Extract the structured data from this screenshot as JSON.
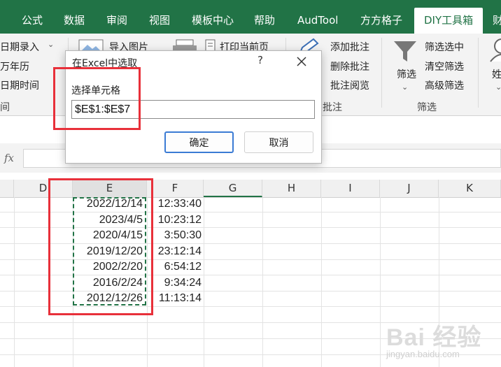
{
  "ribbon_tabs": [
    "公式",
    "数据",
    "审阅",
    "视图",
    "模板中心",
    "帮助",
    "AudTool",
    "方方格子",
    "DIY工具箱",
    "财"
  ],
  "active_tab_index": 8,
  "ribbon": {
    "left_items": [
      "日期录入",
      "万年历",
      "日期时间",
      "间"
    ],
    "left_dropdown_icon": "chevron-down-icon",
    "import_image": "导入图片",
    "print_current": "打印当前页",
    "comment_items": [
      "添加批注",
      "删除批注",
      "批注阅览"
    ],
    "comment_group": "批注",
    "filter_big_label": "筛选",
    "filter_items": [
      "筛选选中",
      "清空筛选",
      "高级筛选"
    ],
    "filter_group": "筛选",
    "far_right_label": "姓"
  },
  "formula_bar": {
    "fx": "fx",
    "value": ""
  },
  "columns": [
    "D",
    "E",
    "F",
    "G",
    "H",
    "I",
    "J",
    "K"
  ],
  "selected_column": "E",
  "active_column": "G",
  "rows": [
    {
      "E": "2022/12/14",
      "F": "12:33:40"
    },
    {
      "E": "2023/4/5",
      "F": "10:23:12"
    },
    {
      "E": "2020/4/15",
      "F": "3:50:30"
    },
    {
      "E": "2019/12/20",
      "F": "23:12:14"
    },
    {
      "E": "2002/2/20",
      "F": "6:54:12"
    },
    {
      "E": "2016/2/24",
      "F": "9:34:24"
    },
    {
      "E": "2012/12/26",
      "F": "11:13:14"
    }
  ],
  "dialog": {
    "title": "在Excel中选取",
    "help": "?",
    "label": "选择单元格",
    "value": "$E$1:$E$7",
    "ok": "确定",
    "cancel": "取消"
  },
  "watermark": {
    "main": "Bai 经验",
    "sub": "jingyan.baidu.com"
  },
  "colors": {
    "excel_green": "#217346",
    "annotation_red": "#e8303a",
    "focus_blue": "#3b7bd4"
  }
}
